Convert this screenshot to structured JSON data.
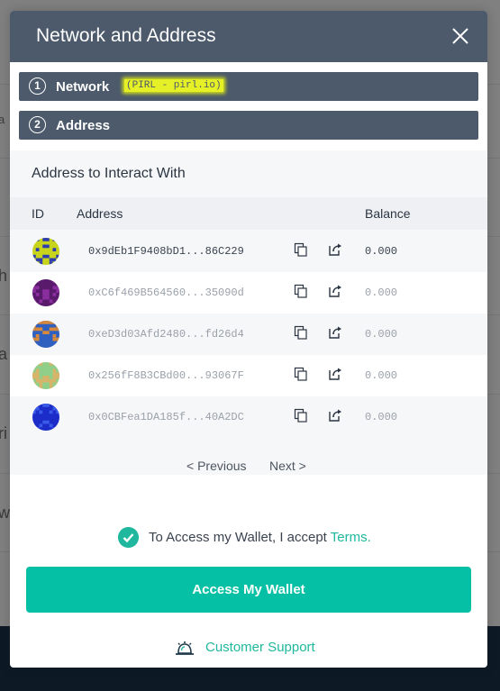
{
  "modal": {
    "title": "Network and Address",
    "close_icon": "close-icon"
  },
  "steps": [
    {
      "number": "1",
      "label": "Network",
      "detail": "(PIRL - pirl.io)"
    },
    {
      "number": "2",
      "label": "Address"
    }
  ],
  "address_table": {
    "title": "Address to Interact With",
    "columns": [
      "ID",
      "Address",
      "Balance"
    ],
    "rows": [
      {
        "address": "0x9dEb1F9408bD1...86C229",
        "balance": "0.000",
        "avatar_colors": [
          "#c8d41c",
          "#2d3db0"
        ]
      },
      {
        "address": "0xC6f469B564560...35090d",
        "balance": "0.000",
        "avatar_colors": [
          "#5a1a6b",
          "#8a2ea0"
        ]
      },
      {
        "address": "0xeD3d03Afd2480...fd26d4",
        "balance": "0.000",
        "avatar_colors": [
          "#2f5fbf",
          "#d88a3a"
        ]
      },
      {
        "address": "0x256fF8B3CBd00...93067F",
        "balance": "0.000",
        "avatar_colors": [
          "#8fcf8a",
          "#d8b46a"
        ]
      },
      {
        "address": "0x0CBFea1DA185f...40A2DC",
        "balance": "0.000",
        "avatar_colors": [
          "#1c2cc8",
          "#3a5ae8"
        ]
      }
    ],
    "icons": {
      "copy": "copy-icon",
      "open": "external-link-icon"
    }
  },
  "pagination": {
    "previous": "< Previous",
    "next": "Next >"
  },
  "terms": {
    "prefix": "To Access my Wallet, I accept ",
    "link": "Terms."
  },
  "access_button": "Access My Wallet",
  "support": {
    "label": "Customer Support",
    "icon": "bell-icon"
  },
  "colors": {
    "header": "#4c5a6b",
    "accent": "#05c0a5",
    "highlight": "#e6f026"
  },
  "background": {
    "letters": [
      "a",
      "h",
      "a",
      "ri",
      "w"
    ]
  }
}
